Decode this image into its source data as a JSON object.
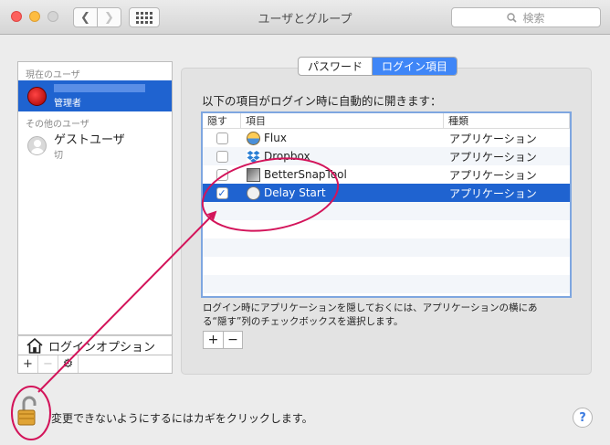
{
  "window": {
    "title": "ユーザとグループ",
    "search_placeholder": "検索"
  },
  "sidebar": {
    "current_users_header": "現在のユーザ",
    "current_user_role": "管理者",
    "other_users_header": "その他のユーザ",
    "guest_name": "ゲストユーザ",
    "guest_status": "切",
    "login_options_label": "ログインオプション",
    "tools": [
      "+",
      "−",
      "⚙"
    ]
  },
  "tabs": {
    "password": "パスワード",
    "login_items": "ログイン項目"
  },
  "login_items": {
    "intro": "以下の項目がログイン時に自動的に開きます：",
    "columns": [
      "隠す",
      "項目",
      "種類"
    ],
    "rows": [
      {
        "name": "Flux",
        "kind": "アプリケーション",
        "hide_checked": false,
        "selected": false
      },
      {
        "name": "Dropbox",
        "kind": "アプリケーション",
        "hide_checked": false,
        "selected": false
      },
      {
        "name": "BetterSnapTool",
        "kind": "アプリケーション",
        "hide_checked": false,
        "selected": false
      },
      {
        "name": "Delay Start",
        "kind": "アプリケーション",
        "hide_checked": true,
        "selected": true
      }
    ],
    "help_text": "ログイン時にアプリケーションを隠しておくには、アプリケーションの横にある“隠す”列のチェックボックスを選択します。",
    "add_label": "+",
    "remove_label": "−"
  },
  "footer": {
    "lock_text": "変更できないようにするにはカギをクリックします。",
    "help_label": "?"
  },
  "annotation": {
    "color": "#d3145a"
  }
}
